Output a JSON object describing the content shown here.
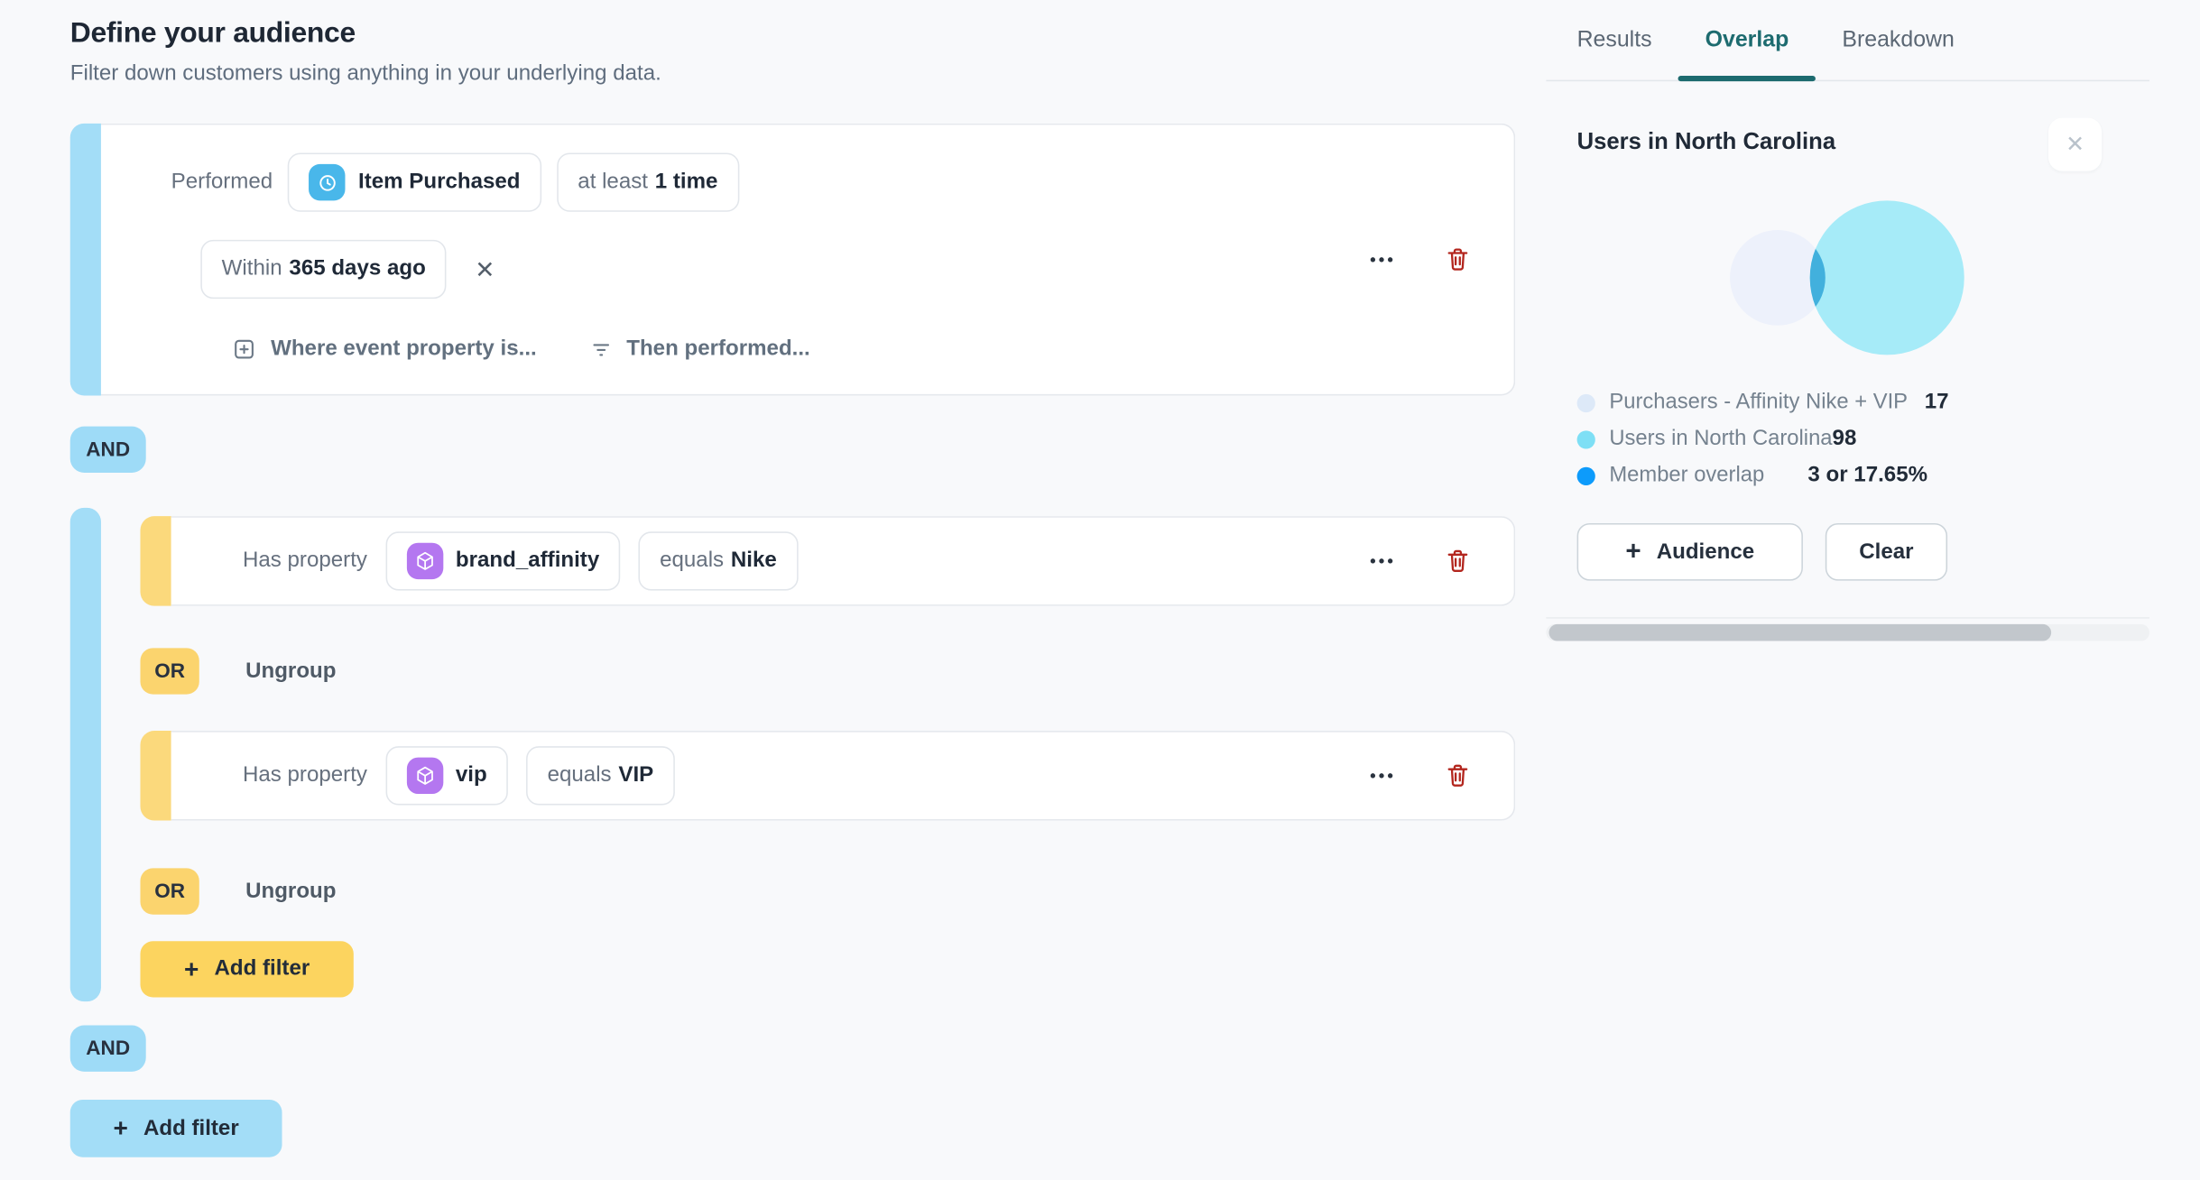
{
  "header": {
    "title": "Define your audience",
    "subtitle": "Filter down customers using anything in your underlying data."
  },
  "glyphs": {
    "plus": "+",
    "close": "✕",
    "more": "•••"
  },
  "colors": {
    "accent_blue": "#a3ddf7",
    "accent_yellow": "#fbd46e",
    "active_tab_teal": "#1d6b6f",
    "danger_red": "#b3261e",
    "event_icon_bg": "#49b7ea",
    "property_icon_bg": "#b477f0"
  },
  "event_filter": {
    "verb": "Performed",
    "event_icon": "clock-icon",
    "event_name": "Item Purchased",
    "frequency_prefix": "at least",
    "frequency_value": "1 time",
    "window_prefix": "Within",
    "window_value": "365 days ago",
    "where_link": "Where event property is...",
    "then_link": "Then performed..."
  },
  "connectors": {
    "and_label": "AND",
    "or_label": "OR",
    "ungroup_label": "Ungroup"
  },
  "group": {
    "filters": [
      {
        "verb": "Has property",
        "property_icon": "cube-icon",
        "property": "brand_affinity",
        "operator": "equals",
        "value": "Nike"
      },
      {
        "verb": "Has property",
        "property_icon": "cube-icon",
        "property": "vip",
        "operator": "equals",
        "value": "VIP"
      }
    ],
    "add_filter_label": "Add filter"
  },
  "root_add_filter_label": "Add filter",
  "panel": {
    "tabs": [
      {
        "label": "Results"
      },
      {
        "label": "Overlap"
      },
      {
        "label": "Breakdown"
      }
    ],
    "active_tab": "Overlap",
    "title": "Users in North Carolina",
    "venn": {
      "left_color": "#edf1fb",
      "right_color": "#a6ebf8",
      "overlap_color": "#42b0dd"
    },
    "legend": [
      {
        "label": "Purchasers - Affinity Nike + VIP",
        "value": "17",
        "color": "#dde9f8"
      },
      {
        "label": "Users in North Carolina",
        "value": "98",
        "color": "#7edff5"
      },
      {
        "label": "Member overlap",
        "value": "3 or 17.65%",
        "color": "#0d9bfb"
      }
    ],
    "audience_button_label": "Audience",
    "clear_button_label": "Clear"
  }
}
